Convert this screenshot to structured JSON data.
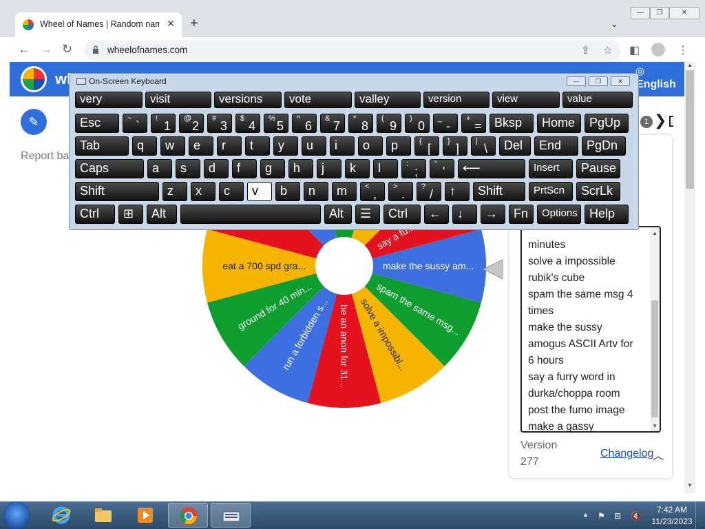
{
  "browser": {
    "tab_title": "Wheel of Names | Random name picker",
    "tab_close": "✕",
    "new_tab": "+",
    "tab_search": "⌄",
    "window_controls": [
      "—",
      "❐",
      "✕"
    ],
    "url": "wheelofnames.com",
    "nav": {
      "back": "←",
      "forward": "→",
      "reload": "↻"
    },
    "toolbar_icons": {
      "share": "⇪",
      "bookmark": "☆",
      "sidepanel": "◧",
      "menu": "⋮"
    }
  },
  "app": {
    "name": "wheelofnames",
    "language": "English",
    "report_text": "Report bad content",
    "badge_count": "1",
    "edit_icon": "✎",
    "chevron": "❯"
  },
  "wheel": {
    "colors": {
      "red": "#e4121f",
      "blue": "#3d6fe0",
      "green": "#0f9d2f",
      "yellow": "#f4b400",
      "hub": "#ffffff"
    },
    "slices": [
      {
        "label": "make the sussy am...",
        "color": "blue"
      },
      {
        "label": "spam the same msg...",
        "color": "green"
      },
      {
        "label": "solve a impossibl...",
        "color": "yellow"
      },
      {
        "label": "be an anon for 31...",
        "color": "red"
      },
      {
        "label": "run a forbidden s...",
        "color": "blue"
      },
      {
        "label": "ground for 40 min...",
        "color": "green"
      },
      {
        "label": "eat a 700 spd gra...",
        "color": "yellow"
      },
      {
        "label": "",
        "color": "red"
      },
      {
        "label": "",
        "color": "blue"
      },
      {
        "label": "",
        "color": "green"
      },
      {
        "label": "",
        "color": "yellow"
      },
      {
        "label": "say a fu...",
        "color": "red"
      }
    ]
  },
  "entries": {
    "lines": [
      "minutes",
      "solve a impossible",
      "rubik's cube",
      "spam the same msg 4",
      "times",
      "make the sussy",
      "amogus ASCII Artv for",
      "6 hours",
      "say a furry word in",
      "durka/choppa room",
      "post the fumo image",
      "make a gassy"
    ],
    "version_label": "Version",
    "version_number": "277",
    "changelog": "Changelog",
    "changelog_chevron": "︿"
  },
  "osk": {
    "title": "On-Screen Keyboard",
    "controls": [
      "—",
      "❐",
      "✕"
    ],
    "predictions": [
      "very",
      "visit",
      "versions",
      "vote",
      "valley",
      "version",
      "view",
      "value"
    ],
    "rows": [
      [
        {
          "t": "Esc"
        },
        {
          "top": "~",
          "bot": "`"
        },
        {
          "top": "!",
          "bot": "1"
        },
        {
          "top": "@",
          "bot": "2"
        },
        {
          "top": "#",
          "bot": "3"
        },
        {
          "top": "$",
          "bot": "4"
        },
        {
          "top": "%",
          "bot": "5"
        },
        {
          "top": "^",
          "bot": "6"
        },
        {
          "top": "&",
          "bot": "7"
        },
        {
          "top": "*",
          "bot": "8"
        },
        {
          "top": "(",
          "bot": "9"
        },
        {
          "top": ")",
          "bot": "0"
        },
        {
          "top": "_",
          "bot": "-"
        },
        {
          "top": "+",
          "bot": "="
        },
        {
          "t": "Bksp"
        },
        {
          "t": "Home"
        },
        {
          "t": "PgUp"
        }
      ],
      [
        {
          "t": "Tab"
        },
        {
          "t": "q"
        },
        {
          "t": "w"
        },
        {
          "t": "e"
        },
        {
          "t": "r"
        },
        {
          "t": "t"
        },
        {
          "t": "y"
        },
        {
          "t": "u"
        },
        {
          "t": "i"
        },
        {
          "t": "o"
        },
        {
          "t": "p"
        },
        {
          "top": "{",
          "bot": "["
        },
        {
          "top": "}",
          "bot": "]"
        },
        {
          "top": "|",
          "bot": "\\"
        },
        {
          "t": "Del"
        },
        {
          "t": "End"
        },
        {
          "t": "PgDn"
        }
      ],
      [
        {
          "t": "Caps"
        },
        {
          "t": "a"
        },
        {
          "t": "s"
        },
        {
          "t": "d"
        },
        {
          "t": "f"
        },
        {
          "t": "g"
        },
        {
          "t": "h"
        },
        {
          "t": "j"
        },
        {
          "t": "k"
        },
        {
          "t": "l"
        },
        {
          "top": ":",
          "bot": ";"
        },
        {
          "top": "\"",
          "bot": "'"
        },
        {
          "t": "⟵"
        },
        {
          "t": "Insert"
        },
        {
          "t": "Pause"
        }
      ],
      [
        {
          "t": "Shift"
        },
        {
          "t": "z"
        },
        {
          "t": "x"
        },
        {
          "t": "c"
        },
        {
          "t": "v"
        },
        {
          "t": "b"
        },
        {
          "t": "n"
        },
        {
          "t": "m"
        },
        {
          "top": "<",
          "bot": ","
        },
        {
          "top": ">",
          "bot": "."
        },
        {
          "top": "?",
          "bot": "/"
        },
        {
          "t": "↑"
        },
        {
          "t": "Shift"
        },
        {
          "t": "PrtScn"
        },
        {
          "t": "ScrLk"
        }
      ],
      [
        {
          "t": "Ctrl"
        },
        {
          "t": "⊞"
        },
        {
          "t": "Alt"
        },
        {
          "t": ""
        },
        {
          "t": "Alt"
        },
        {
          "t": "☰"
        },
        {
          "t": "Ctrl"
        },
        {
          "t": "←"
        },
        {
          "t": "↓"
        },
        {
          "t": "→"
        },
        {
          "t": "Fn"
        },
        {
          "t": "Options"
        },
        {
          "t": "Help"
        }
      ]
    ]
  },
  "taskbar": {
    "time": "7:42 AM",
    "date": "11/23/2023",
    "tray_icons": {
      "show_hidden": "▲",
      "network": "⚑",
      "action": "⊟",
      "volume": "🔇"
    }
  }
}
